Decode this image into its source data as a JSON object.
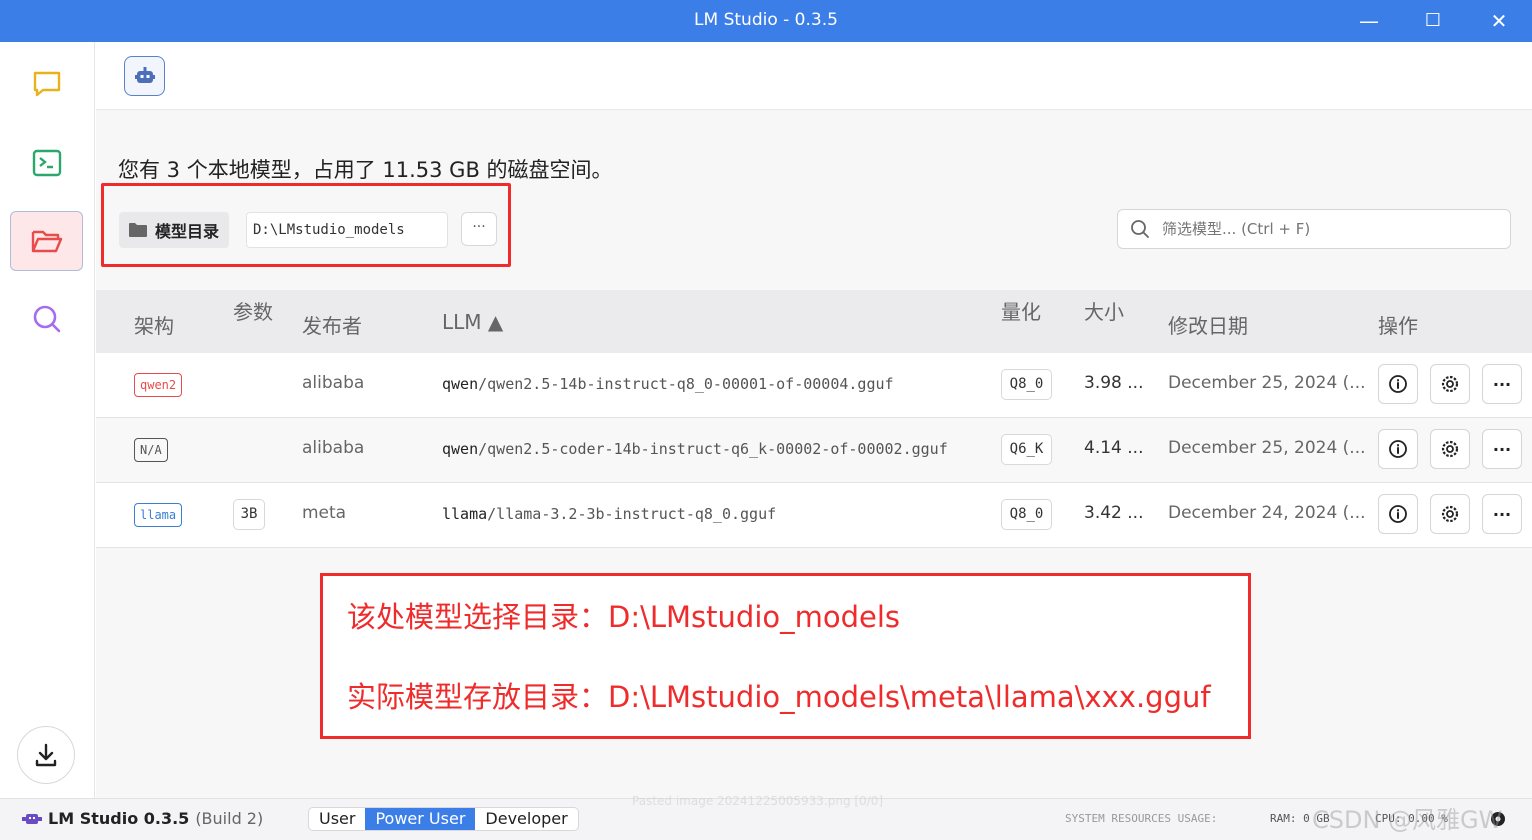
{
  "window": {
    "title": "LM Studio - 0.3.5",
    "minimize": "—",
    "maximize": "☐",
    "close": "✕"
  },
  "summary": "您有 3 个本地模型，占用了 11.53 GB 的磁盘空间。",
  "model_dir": {
    "label": "模型目录",
    "path": "D:\\LMstudio_models",
    "more": "···"
  },
  "search": {
    "placeholder": "筛选模型... (Ctrl + F)"
  },
  "table": {
    "headers": {
      "arch": "架构",
      "params": "参数",
      "publisher": "发布者",
      "llm": "LLM ▲",
      "quant": "量化",
      "size": "大小",
      "modified": "修改日期",
      "actions": "操作"
    },
    "rows": [
      {
        "arch": "qwen2",
        "arch_color": "#e84b4b",
        "params": "",
        "publisher": "alibaba",
        "file_prefix": "qwen",
        "file_rest": "/qwen2.5-14b-instruct-q8_0-00001-of-00004.gguf",
        "quant": "Q8_0",
        "size": "3.98 ...",
        "modified": "December 25, 2024 (..."
      },
      {
        "arch": "N/A",
        "arch_color": "#555555",
        "params": "",
        "publisher": "alibaba",
        "file_prefix": "qwen",
        "file_rest": "/qwen2.5-coder-14b-instruct-q6_k-00002-of-00002.gguf",
        "quant": "Q6_K",
        "size": "4.14 ...",
        "modified": "December 25, 2024 (..."
      },
      {
        "arch": "llama",
        "arch_color": "#3a7fd5",
        "params": "3B",
        "publisher": "meta",
        "file_prefix": "llama",
        "file_rest": "/llama-3.2-3b-instruct-q8_0.gguf",
        "quant": "Q8_0",
        "size": "3.42 ...",
        "modified": "December 24, 2024 (..."
      }
    ]
  },
  "annotation": {
    "line1": "该处模型选择目录：D:\\LMstudio_models",
    "line2": "实际模型存放目录：D:\\LMstudio_models\\meta\\llama\\xxx.gguf"
  },
  "statusbar": {
    "app": "LM Studio 0.3.5",
    "build": "(Build 2)",
    "modes": [
      "User",
      "Power User",
      "Developer"
    ],
    "selected_mode": "Power User",
    "sys_label": "SYSTEM RESOURCES USAGE:",
    "ram": "RAM: 0 GB",
    "cpu": "CPU: 0.00 %"
  },
  "watermark": "CSDN @风雅GW",
  "watermark_paste": "Pasted image 20241225005933.png [0/0]",
  "colors": {
    "accent": "#3c7ee8",
    "annotation": "#ef2b2b",
    "chat_icon": "#e8b21a",
    "terminal_icon": "#2aa86b",
    "folder_icon": "#e84b4b",
    "search_icon": "#a56cf0"
  }
}
